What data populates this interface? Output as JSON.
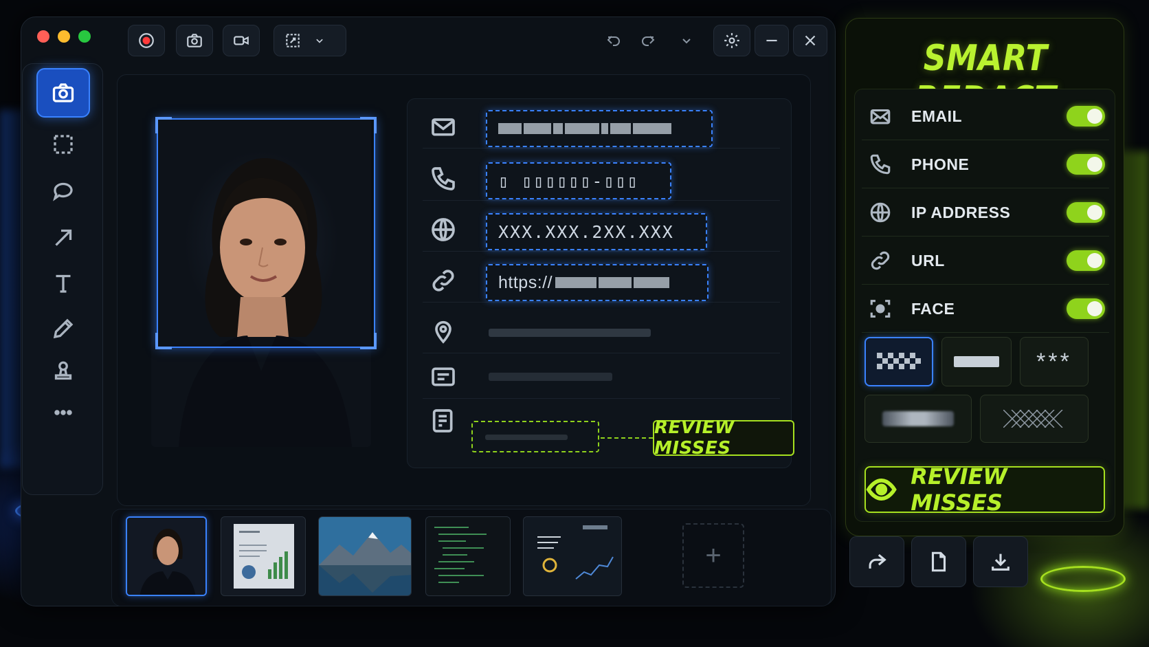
{
  "window": {
    "toolbar": {
      "record": "record-icon",
      "screenshot": "camera-icon",
      "video": "video-camera-icon",
      "region": "crop-icon",
      "settings": "gear-icon"
    },
    "tools": [
      "camera-icon",
      "selection-icon",
      "speech-bubble-icon",
      "arrow-icon",
      "text-icon",
      "pencil-icon",
      "stamp-icon",
      "more-icon"
    ]
  },
  "editor": {
    "fields": [
      {
        "icon": "email-icon",
        "type": "email",
        "redacted": true
      },
      {
        "icon": "phone-icon",
        "text": "▯ ▯▯▯▯▯▯-▯▯▯",
        "type": "phone",
        "redacted": true
      },
      {
        "icon": "globe-icon",
        "text": "XXX.XXX.2XX.XXX",
        "type": "ip",
        "redacted": true
      },
      {
        "icon": "link-icon",
        "text": "https://",
        "type": "url",
        "redacted": true
      },
      {
        "icon": "location-pin-icon",
        "type": "address",
        "redacted": false
      },
      {
        "icon": "card-icon",
        "type": "card",
        "redacted": false
      },
      {
        "icon": "note-icon",
        "type": "note",
        "redacted": false
      }
    ],
    "review_label": "REVIEW MISSES"
  },
  "panel": {
    "title": "SMART REDACT",
    "toggles": [
      {
        "label": "EMAIL",
        "icon": "envelope-icon",
        "on": true
      },
      {
        "label": "PHONE",
        "icon": "phone-icon",
        "on": true
      },
      {
        "label": "IP ADDRESS",
        "icon": "globe-icon",
        "on": true
      },
      {
        "label": "URL",
        "icon": "link-icon",
        "on": true
      },
      {
        "label": "FACE",
        "icon": "face-scan-icon",
        "on": true
      }
    ],
    "styles": [
      "pixelate",
      "solid-bar",
      "asterisks",
      "blur",
      "crosshatch"
    ],
    "asterisks": "***",
    "review_button": "REVIEW MISSES"
  },
  "actions": [
    "share-icon",
    "document-icon",
    "download-icon"
  ],
  "colors": {
    "blue_accent": "#3a82ff",
    "green_accent": "#a6e01f"
  }
}
